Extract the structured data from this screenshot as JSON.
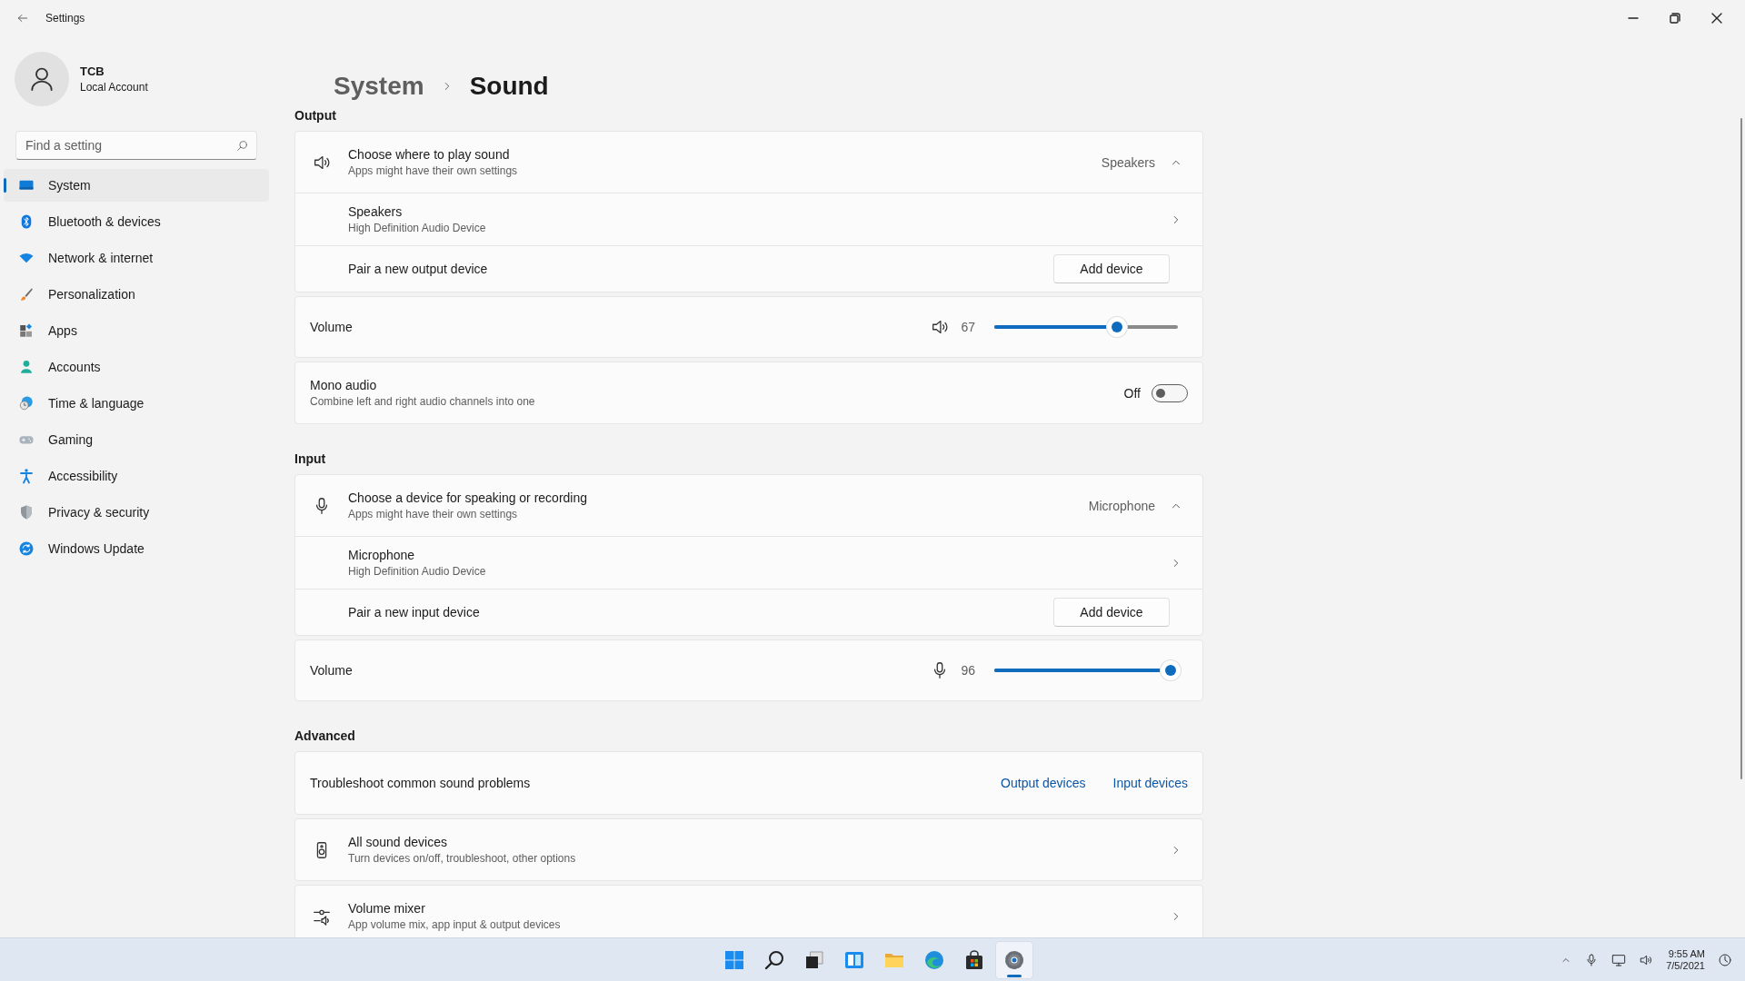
{
  "window": {
    "title": "Settings"
  },
  "user": {
    "name": "TCB",
    "account": "Local Account"
  },
  "search": {
    "placeholder": "Find a setting"
  },
  "nav": [
    {
      "label": "System",
      "selected": true
    },
    {
      "label": "Bluetooth & devices",
      "selected": false
    },
    {
      "label": "Network & internet",
      "selected": false
    },
    {
      "label": "Personalization",
      "selected": false
    },
    {
      "label": "Apps",
      "selected": false
    },
    {
      "label": "Accounts",
      "selected": false
    },
    {
      "label": "Time & language",
      "selected": false
    },
    {
      "label": "Gaming",
      "selected": false
    },
    {
      "label": "Accessibility",
      "selected": false
    },
    {
      "label": "Privacy & security",
      "selected": false
    },
    {
      "label": "Windows Update",
      "selected": false
    }
  ],
  "breadcrumb": {
    "parent": "System",
    "current": "Sound"
  },
  "sections": [
    {
      "heading": "Output",
      "cards": [
        {
          "kind": "expander",
          "title": "Choose where to play sound",
          "subtitle": "Apps might have their own settings",
          "value": "Speakers",
          "expanded": true,
          "rows": [
            {
              "kind": "device",
              "title": "Speakers",
              "subtitle": "High Definition Audio Device"
            },
            {
              "kind": "pair",
              "title": "Pair a new output device",
              "button": "Add device"
            }
          ]
        },
        {
          "kind": "slider",
          "label": "Volume",
          "reading": "67",
          "level": 0.67
        },
        {
          "kind": "toggle",
          "title": "Mono audio",
          "subtitle": "Combine left and right audio channels into one",
          "state_label": "Off",
          "on": false
        }
      ]
    },
    {
      "heading": "Input",
      "cards": [
        {
          "kind": "expander",
          "title": "Choose a device for speaking or recording",
          "subtitle": "Apps might have their own settings",
          "value": "Microphone",
          "expanded": true,
          "rows": [
            {
              "kind": "device",
              "title": "Microphone",
              "subtitle": "High Definition Audio Device"
            },
            {
              "kind": "pair",
              "title": "Pair a new input device",
              "button": "Add device"
            }
          ]
        },
        {
          "kind": "slider",
          "label": "Volume",
          "reading": "96",
          "level": 0.96
        }
      ]
    },
    {
      "heading": "Advanced",
      "cards": [
        {
          "kind": "links",
          "title": "Troubleshoot common sound problems",
          "links": [
            "Output devices",
            "Input devices"
          ]
        },
        {
          "kind": "nav",
          "title": "All sound devices",
          "subtitle": "Turn devices on/off, troubleshoot, other options"
        },
        {
          "kind": "nav",
          "title": "Volume mixer",
          "subtitle": "App volume mix, app input & output devices"
        }
      ]
    }
  ],
  "taskbar": {
    "apps": [
      {
        "selected": false
      },
      {
        "selected": false
      },
      {
        "selected": false
      },
      {
        "selected": false
      },
      {
        "selected": false
      },
      {
        "selected": false
      },
      {
        "selected": false
      },
      {
        "selected": true
      }
    ],
    "time": "9:55 AM",
    "date": "7/5/2021"
  }
}
